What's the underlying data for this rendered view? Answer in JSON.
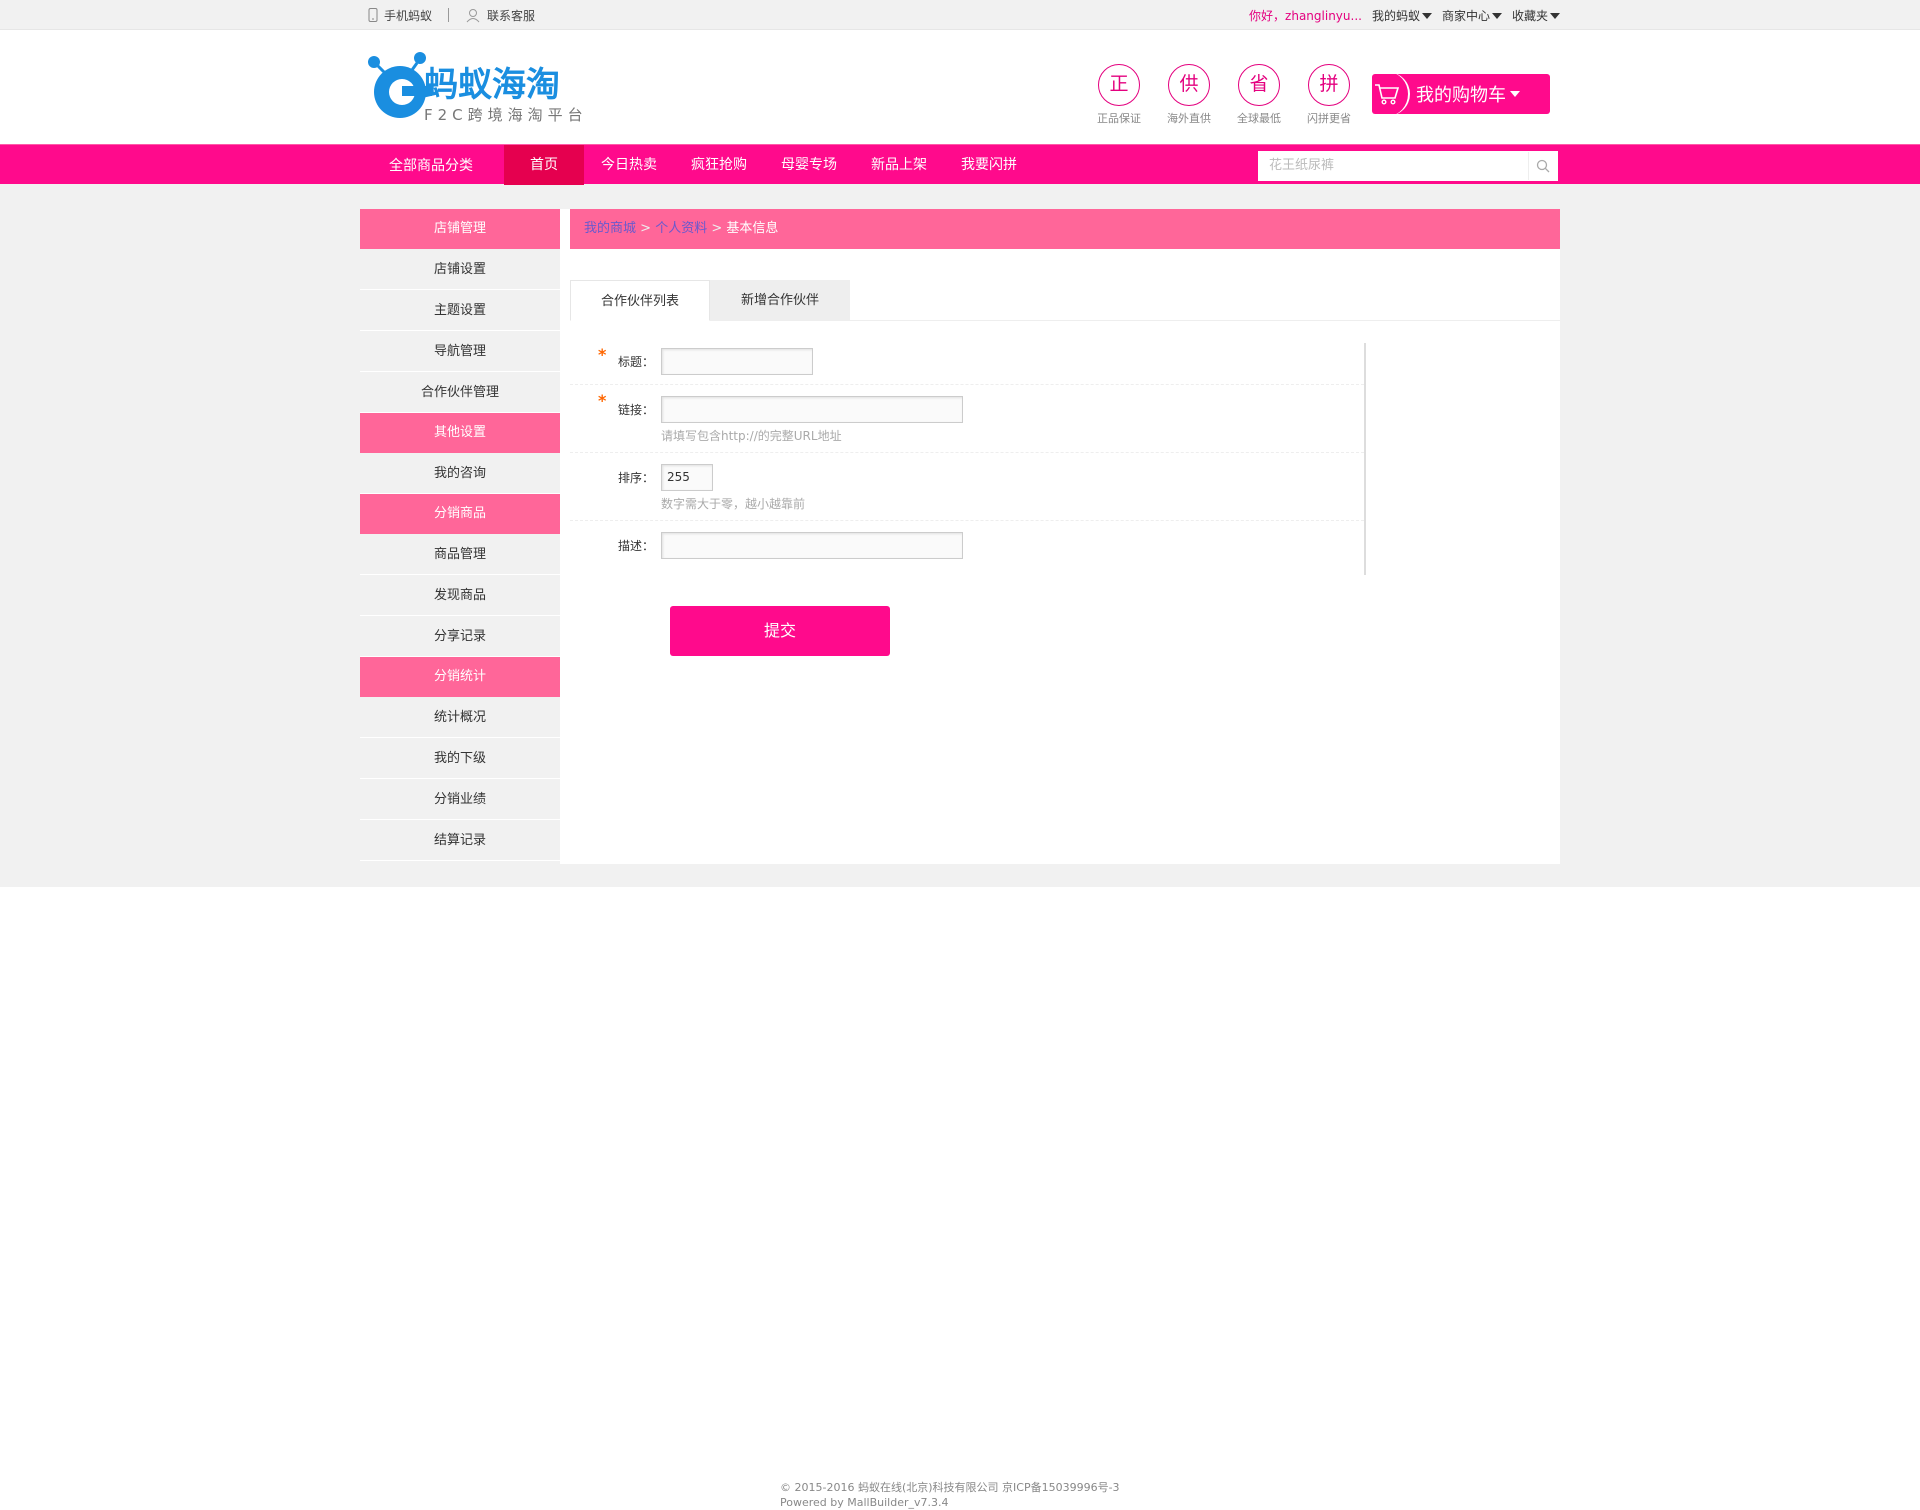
{
  "topbar": {
    "mobile": "手机蚂蚁",
    "service": "联系客服",
    "hello": "你好，zhanglinyu...",
    "my_ant": "我的蚂蚁",
    "seller_center": "商家中心",
    "favorites": "收藏夹"
  },
  "header": {
    "logo_title": "蚂蚁海淘",
    "logo_sub": "F2C跨境海淘平台",
    "promises": [
      {
        "char": "正",
        "label": "正品保证"
      },
      {
        "char": "供",
        "label": "海外直供"
      },
      {
        "char": "省",
        "label": "全球最低"
      },
      {
        "char": "拼",
        "label": "闪拼更省"
      }
    ],
    "cart_label": "我的购物车"
  },
  "nav": {
    "all_categories": "全部商品分类",
    "items": [
      "首页",
      "今日热卖",
      "疯狂抢购",
      "母婴专场",
      "新品上架",
      "我要闪拼"
    ],
    "search_placeholder": "花王纸尿裤"
  },
  "sidebar": {
    "groups": [
      {
        "title": "店铺管理",
        "items": [
          "店铺设置",
          "主题设置",
          "导航管理",
          "合作伙伴管理"
        ]
      },
      {
        "title": "其他设置",
        "items": [
          "我的咨询"
        ]
      },
      {
        "title": "分销商品",
        "items": [
          "商品管理",
          "发现商品",
          "分享记录"
        ]
      },
      {
        "title": "分销统计",
        "items": [
          "统计概况",
          "我的下级",
          "分销业绩",
          "结算记录"
        ]
      }
    ]
  },
  "breadcrumb": {
    "home": "我的商城",
    "profile": "个人资料",
    "current": "基本信息",
    "sep": ">"
  },
  "tabs": [
    "合作伙伴列表",
    "新增合作伙伴"
  ],
  "form": {
    "title_label": "标题：",
    "link_label": "链接：",
    "link_hint": "请填写包含http://的完整URL地址",
    "sort_label": "排序：",
    "sort_value": "255",
    "sort_hint": "数字需大于零，越小越靠前",
    "desc_label": "描述：",
    "submit": "提交"
  },
  "footer": {
    "copyright": "© 2015-2016 蚂蚁在线(北京)科技有限公司 京ICP备15039996号-3",
    "powered": "Powered by MallBuilder_v7.3.4"
  },
  "colors": {
    "brand_pink": "#ff0a8c",
    "sidebar_pink": "#ff6699",
    "logo_blue": "#1a8ee0"
  }
}
